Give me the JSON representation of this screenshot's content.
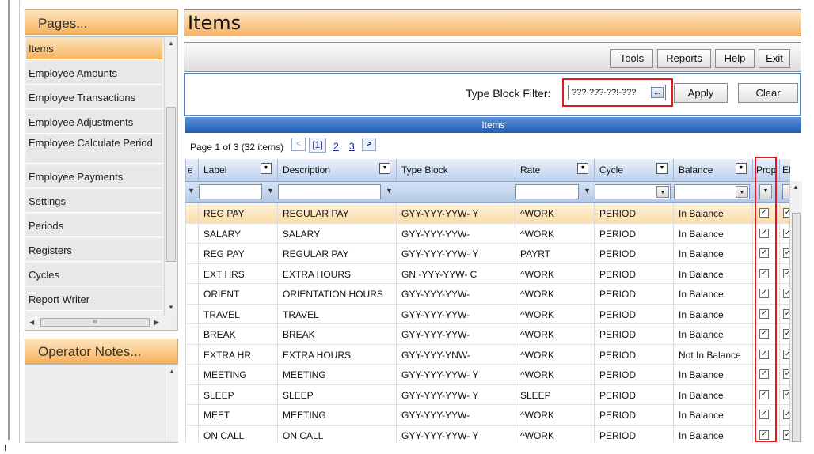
{
  "left": {
    "pages_title": "Pages...",
    "pages": [
      "Items",
      "Employee Amounts",
      "Employee Transactions",
      "Employee Adjustments",
      "Employee Calculate Period",
      "Employee Payments",
      "Settings",
      "Periods",
      "Registers",
      "Cycles",
      "Report Writer"
    ],
    "active_page": "Items",
    "notes_title": "Operator Notes..."
  },
  "main": {
    "title": "Items",
    "toolbar": {
      "tools": "Tools",
      "reports": "Reports",
      "help": "Help",
      "exit": "Exit"
    },
    "filter": {
      "label": "Type Block Filter:",
      "value": "???-???-??!-???",
      "browse": "...",
      "apply": "Apply",
      "clear": "Clear"
    },
    "grid_caption": "Items",
    "pager": {
      "text": "Page 1 of 3 (32 items)",
      "current": "[1]",
      "p2": "2",
      "p3": "3",
      "prev": "<",
      "next": ">"
    },
    "columns": {
      "e": "e",
      "label": "Label",
      "description": "Description",
      "type_block": "Type Block",
      "rate": "Rate",
      "cycle": "Cycle",
      "balance": "Balance",
      "prop": "Prop",
      "el": "El"
    },
    "rows": [
      {
        "label": "REG PAY",
        "description": "REGULAR PAY",
        "type_block": "GYY-YYY-YYW- Y",
        "rate": "^WORK",
        "cycle": "PERIOD",
        "balance": "In Balance"
      },
      {
        "label": "SALARY",
        "description": "SALARY",
        "type_block": "GYY-YYY-YYW-",
        "rate": "^WORK",
        "cycle": "PERIOD",
        "balance": "In Balance"
      },
      {
        "label": "REG PAY",
        "description": "REGULAR PAY",
        "type_block": "GYY-YYY-YYW- Y",
        "rate": "PAYRT",
        "cycle": "PERIOD",
        "balance": "In Balance"
      },
      {
        "label": "EXT HRS",
        "description": "EXTRA HOURS",
        "type_block": "GN -YYY-YYW- C",
        "rate": "^WORK",
        "cycle": "PERIOD",
        "balance": "In Balance"
      },
      {
        "label": "ORIENT",
        "description": "ORIENTATION HOURS",
        "type_block": "GYY-YYY-YYW-",
        "rate": "^WORK",
        "cycle": "PERIOD",
        "balance": "In Balance"
      },
      {
        "label": "TRAVEL",
        "description": "TRAVEL",
        "type_block": "GYY-YYY-YYW-",
        "rate": "^WORK",
        "cycle": "PERIOD",
        "balance": "In Balance"
      },
      {
        "label": "BREAK",
        "description": "BREAK",
        "type_block": "GYY-YYY-YYW-",
        "rate": "^WORK",
        "cycle": "PERIOD",
        "balance": "In Balance"
      },
      {
        "label": "EXTRA HR",
        "description": "EXTRA HOURS",
        "type_block": "GYY-YYY-YNW-",
        "rate": "^WORK",
        "cycle": "PERIOD",
        "balance": "Not In Balance"
      },
      {
        "label": "MEETING",
        "description": "MEETING",
        "type_block": "GYY-YYY-YYW- Y",
        "rate": "^WORK",
        "cycle": "PERIOD",
        "balance": "In Balance"
      },
      {
        "label": "SLEEP",
        "description": "SLEEP",
        "type_block": "GYY-YYY-YYW- Y",
        "rate": "SLEEP",
        "cycle": "PERIOD",
        "balance": "In Balance"
      },
      {
        "label": "MEET",
        "description": "MEETING",
        "type_block": "GYY-YYY-YYW-",
        "rate": "^WORK",
        "cycle": "PERIOD",
        "balance": "In Balance"
      },
      {
        "label": "ON CALL",
        "description": "ON CALL",
        "type_block": "GYY-YYY-YYW- Y",
        "rate": "^WORK",
        "cycle": "PERIOD",
        "balance": "In Balance"
      }
    ]
  }
}
